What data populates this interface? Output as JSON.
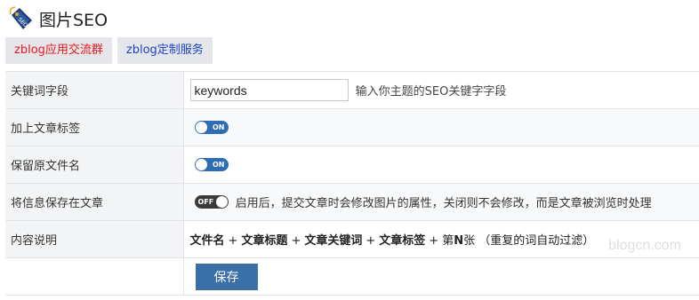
{
  "header": {
    "title": "图片SEO",
    "icon": "seo-tag-icon"
  },
  "tabs": [
    {
      "label": "zblog应用交流群",
      "color": "#e8151c"
    },
    {
      "label": "zblog定制服务",
      "color": "#1a43c4"
    }
  ],
  "rows": {
    "keyword": {
      "label": "关键词字段",
      "value": "keywords",
      "hint": "输入你主题的SEO关键字字段"
    },
    "add_tags": {
      "label": "加上文章标签",
      "toggle": "ON",
      "state": true
    },
    "keep_filename": {
      "label": "保留原文件名",
      "toggle": "ON",
      "state": true
    },
    "save_info": {
      "label": "将信息保存在文章",
      "toggle": "OFF",
      "state": false,
      "hint": "启用后，提交文章时会修改图片的属性，关闭则不会修改，而是文章被浏览时处理"
    },
    "content": {
      "label": "内容说明",
      "parts": [
        "文件名",
        "文章标题",
        "文章关键词",
        "文章标签"
      ],
      "plus": "+",
      "last_prefix": "第",
      "last_bold": "N",
      "last_suffix": "张",
      "note": "（重复的词自动过滤）"
    }
  },
  "save_button": {
    "label": "保存"
  },
  "watermark": "blogcn.com",
  "colors": {
    "accent": "#3b6fa8",
    "toggle_on": "#2e6db4",
    "toggle_off": "#3a3a3a"
  }
}
